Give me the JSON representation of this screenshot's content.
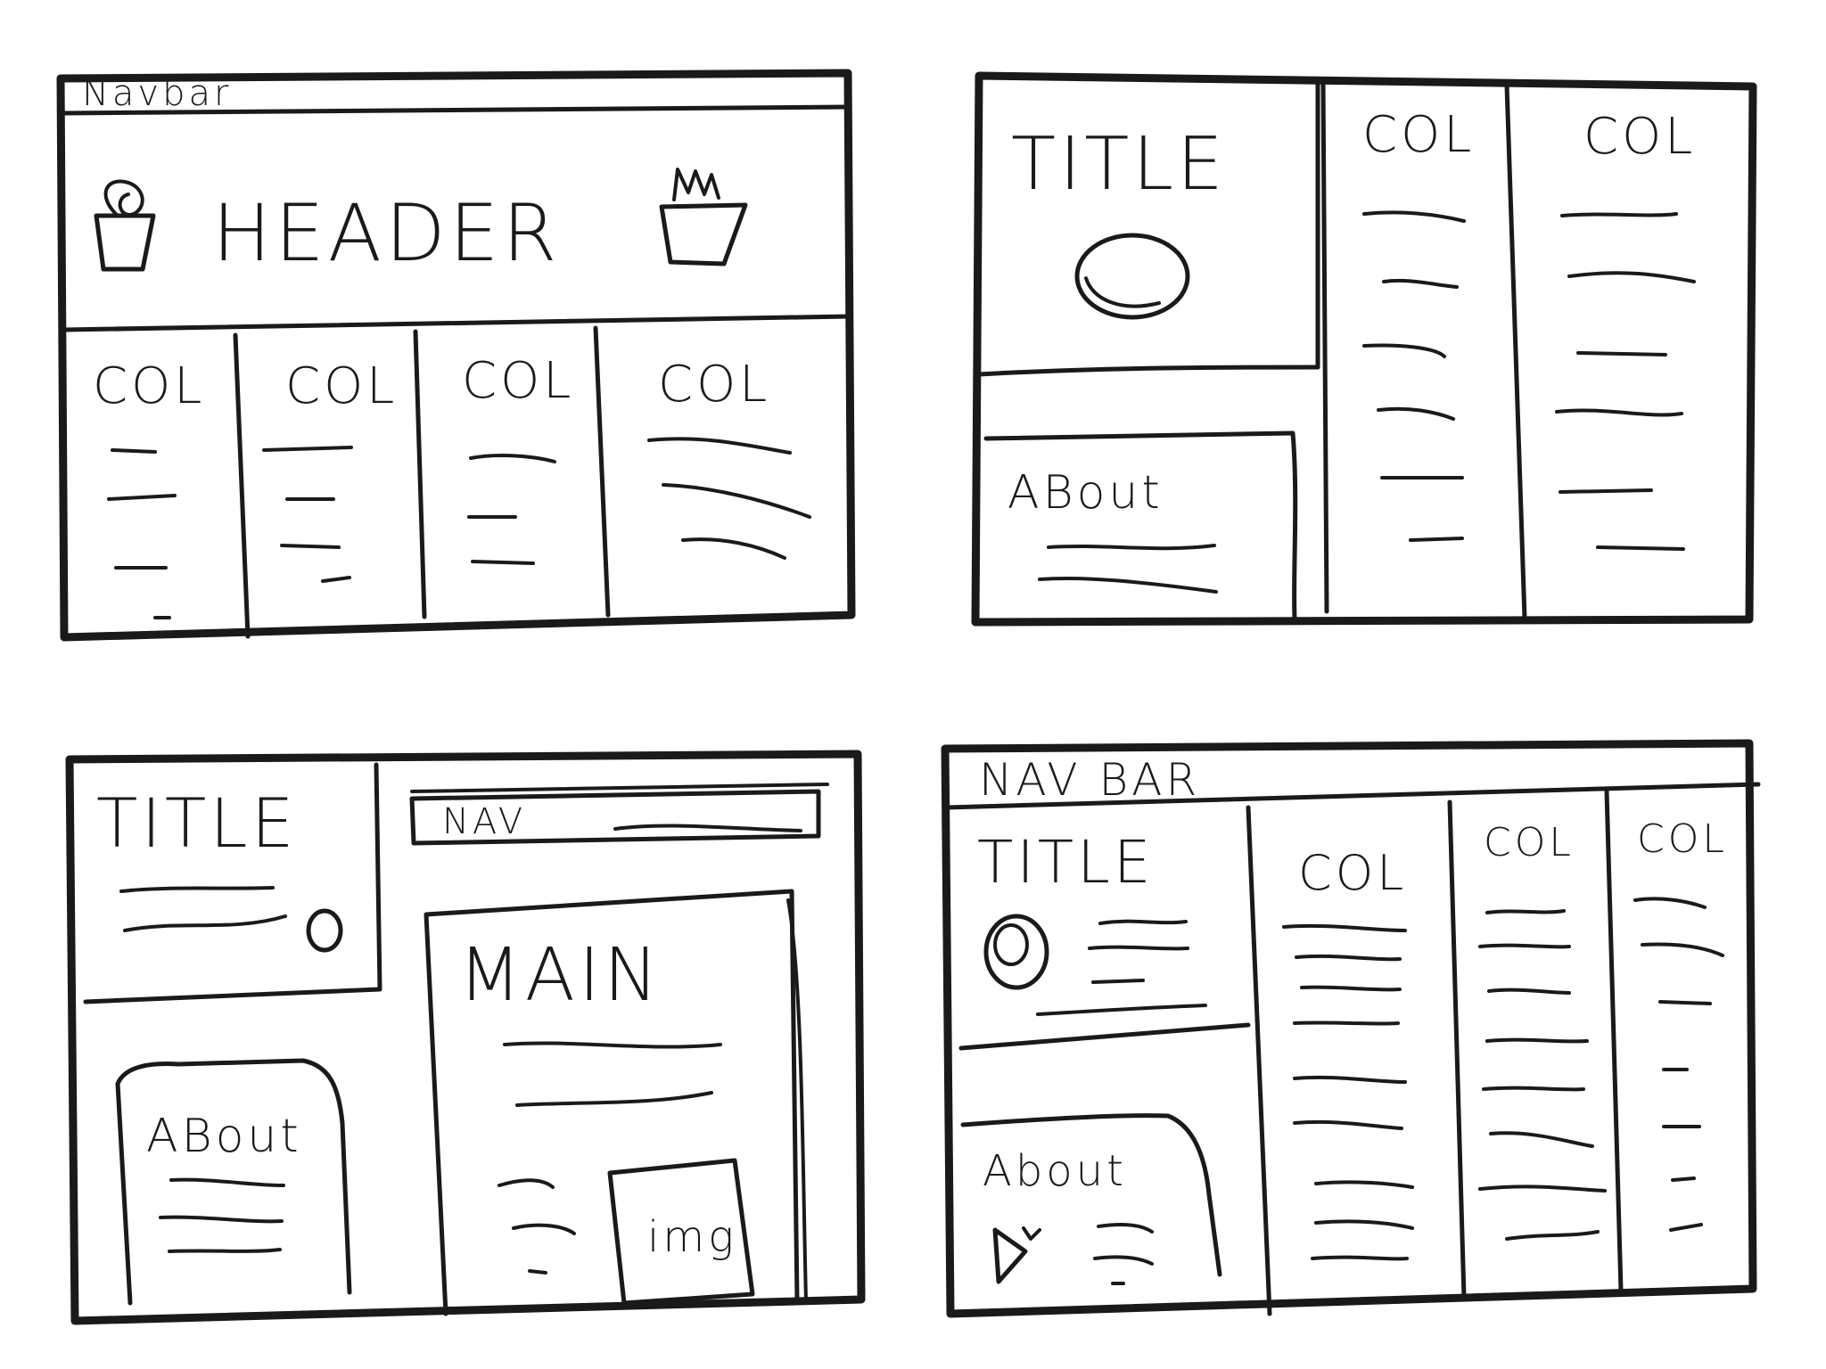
{
  "ink_color": "#1a1a1a",
  "paper_color": "#ffffff",
  "wireframe_1": {
    "navbar_label": "Navbar",
    "header_label": "HEADER",
    "col_labels": [
      "COL",
      "COL",
      "COL",
      "COL"
    ]
  },
  "wireframe_2": {
    "title_label": "TITLE",
    "about_label": "ABout",
    "col_labels": [
      "COL",
      "COL"
    ]
  },
  "wireframe_3": {
    "title_label": "TITLE",
    "nav_label": "NAV",
    "main_label": "MAIN",
    "about_label": "ABout",
    "img_label": "img"
  },
  "wireframe_4": {
    "navbar_label": "NAV BAR",
    "title_label": "TITLE",
    "about_label": "About",
    "col_labels": [
      "COL",
      "COL",
      "COL"
    ]
  }
}
